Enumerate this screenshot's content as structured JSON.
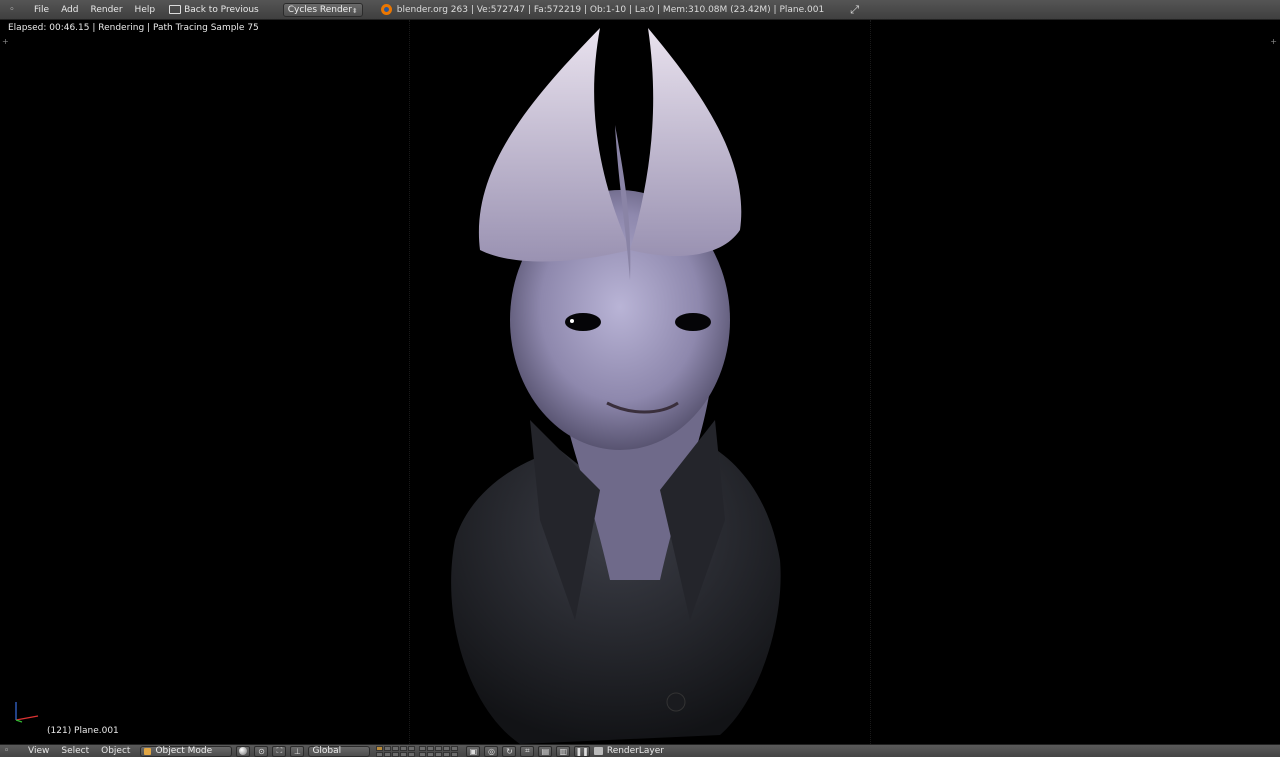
{
  "top_header": {
    "menu": [
      "File",
      "Add",
      "Render",
      "Help"
    ],
    "back_button": "Back to Previous",
    "render_engine": "Cycles Render",
    "stats": "blender.org 263 | Ve:572747 | Fa:572219 | Ob:1-10 | La:0 | Mem:310.08M (23.42M) | Plane.001"
  },
  "viewport": {
    "render_status": "Elapsed: 00:46.15 | Rendering | Path Tracing Sample 75",
    "scene_label": "(121) Plane.001"
  },
  "bottom_header": {
    "menu": [
      "View",
      "Select",
      "Object"
    ],
    "mode": "Object Mode",
    "transform_orientation": "Global",
    "render_layer": "RenderLayer"
  },
  "colors": {
    "header_bg": "#4a4a4a",
    "viewport_bg": "#000000",
    "blender_orange": "#ea7600"
  }
}
